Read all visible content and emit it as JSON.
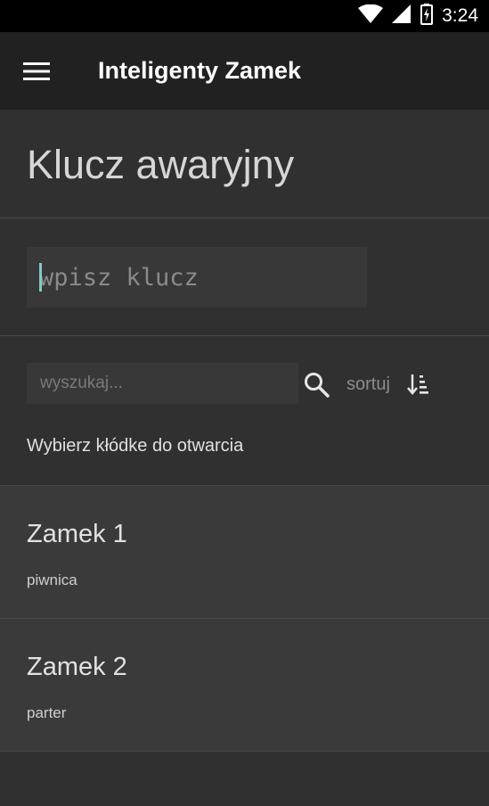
{
  "status_bar": {
    "time": "3:24",
    "icons": [
      "wifi-icon",
      "signal-icon",
      "battery-charging-icon"
    ]
  },
  "app_bar": {
    "menu_icon": "hamburger-menu-icon",
    "title": "Inteligenty Zamek"
  },
  "page": {
    "title": "Klucz awaryjny"
  },
  "key_input": {
    "value": "",
    "placeholder": "wpisz klucz"
  },
  "search": {
    "value": "",
    "placeholder": "wyszukaj...",
    "icon": "search-icon"
  },
  "sort": {
    "label": "sortuj",
    "icon": "sort-ascending-icon"
  },
  "instruction": "Wybierz kłódke do otwarcia",
  "locks": [
    {
      "name": "Zamek 1",
      "location": "piwnica"
    },
    {
      "name": "Zamek 2",
      "location": "parter"
    }
  ],
  "colors": {
    "background": "#303030",
    "app_bar": "#212121",
    "status_bar": "#000000",
    "list_item": "#3a3a3a",
    "accent_caret": "#7fcbc4"
  }
}
